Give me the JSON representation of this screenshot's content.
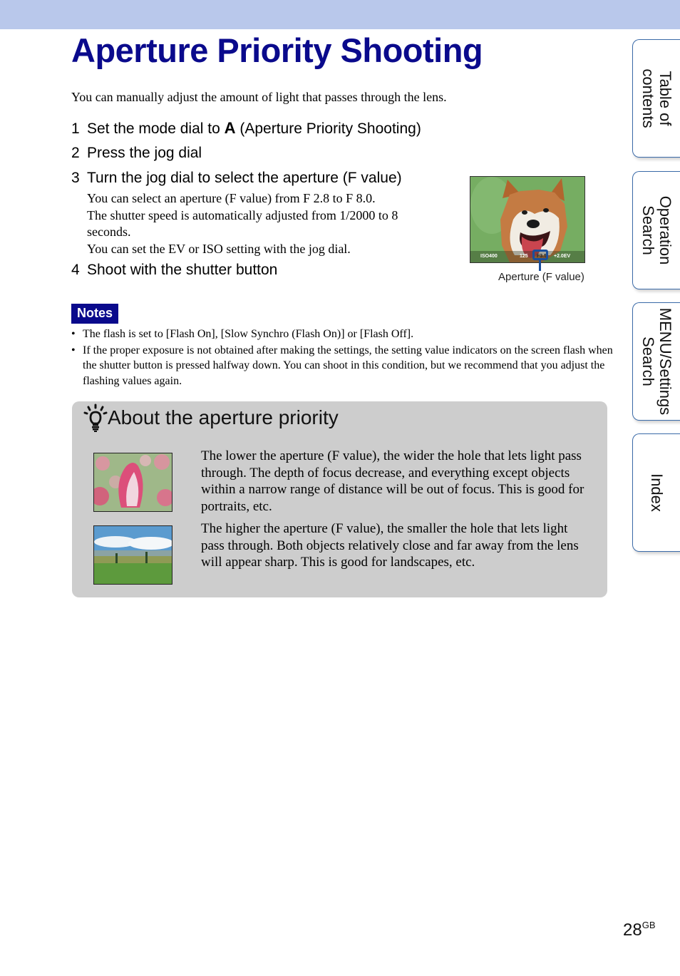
{
  "page": {
    "title": "Aperture Priority Shooting",
    "intro": "You can manually adjust the amount of light that passes through the lens.",
    "page_number": "28",
    "page_suffix": "GB"
  },
  "steps": [
    {
      "num": "1",
      "before": "Set the mode dial to",
      "icon_glyph": "A",
      "after": "(Aperture Priority Shooting)"
    },
    {
      "num": "2",
      "text": "Press the jog dial"
    },
    {
      "num": "3",
      "text": "Turn the jog dial to select the aperture (F value)"
    },
    {
      "num": "4",
      "text": "Shoot with the shutter button"
    }
  ],
  "step3_details": [
    "You can select an aperture (F value) from F 2.8 to F 8.0.",
    "The shutter speed is automatically adjusted from 1/2000 to 8 seconds.",
    "You can set the EV or ISO setting with the jog dial."
  ],
  "lcd_image": {
    "iso": "ISO400",
    "shutter": "125",
    "aperture": "F3.5",
    "ev": "+2.0EV",
    "callout_label": "Aperture (F value)"
  },
  "notes": {
    "label": "Notes",
    "items": [
      "The flash is set to [Flash On], [Slow Synchro (Flash On)] or [Flash Off].",
      "If the proper exposure is not obtained after making the settings, the setting value indicators on the screen flash when the shutter button is pressed halfway down. You can shoot in this condition, but we recommend that you adjust the flashing values again."
    ],
    "bullet": "•"
  },
  "hint": {
    "title": "About the aperture priority",
    "paragraphs": [
      "The lower the aperture (F value), the wider the hole that lets light pass through. The depth of focus decrease, and everything except objects within a narrow range of distance will be out of focus. This is good for portraits, etc.",
      "The higher the aperture (F value), the smaller the hole that lets light pass through. Both objects relatively close and far away from the lens will appear sharp. This is good for landscapes, etc."
    ]
  },
  "side_tabs": [
    {
      "label": "Table of\ncontents"
    },
    {
      "label": "Operation\nSearch"
    },
    {
      "label": "MENU/Settings\nSearch"
    },
    {
      "label": "Index"
    }
  ],
  "colors": {
    "title": "#0a0a8c",
    "top_band": "#b9c8eb",
    "notes_badge": "#0a0a8c",
    "hint_panel": "#cdcdcd",
    "tab_border": "#3a6aa8",
    "callout": "#1a4f9c"
  }
}
